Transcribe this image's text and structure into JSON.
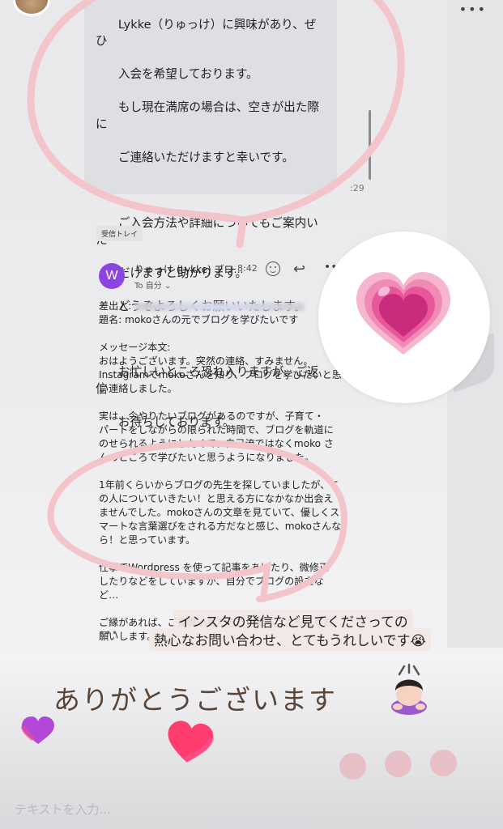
{
  "bubble": {
    "paragraphs": [
      [
        "Lykke（りゅっけ）に興味があり、ぜひ",
        "入会を希望しております。",
        "もし現在満席の場合は、空きが出た際に",
        "ご連絡いただけますと幸いです。"
      ],
      [
        "ご入会方法や詳細についてもご案内いた",
        "だけますと助かります。",
        "どうぞよろしくお願いいたします。"
      ],
      [
        "お忙しいところ恐れ入りますが、ご返信",
        "お待ちしております。"
      ]
    ],
    "time": ":29"
  },
  "inbox_tag": "受信トレイ",
  "mail": {
    "avatar_letter": "W",
    "sender": "りゅっけ (Lykke) ブロ…",
    "time": "8:42",
    "to_me": "To 自分 ⌄",
    "from_label": "差出人:",
    "subject": "題名: mokoさんの元でブログを学びたいです",
    "body_label": "メッセージ本文:",
    "body_paragraphs": [
      [
        "おはようございます。突然の連絡、すみません。",
        "Instagramでmokoさんを知り、ブログを学びたいと思",
        "い連絡しました。"
      ],
      [
        "実は、今やりたいブログがあるのですが、子育て・",
        "パートをしながらの限られた時間で、ブログを軌道に",
        "のせられるようにしたくて、自己流ではなくmoko さ",
        "んのところで学びたいと思うようになりました。"
      ],
      [
        "1年前くらいからブログの先生を探していましたが、こ",
        "の人についていきたい！と思える方になかなか出会え",
        "ませんでした。mokoさんの文章を見ていて、優しくス",
        "マートな言葉選びをされる方だなと感じ、mokoさんな",
        "ら！と思っています。"
      ],
      [
        "仕事でWordpress を使って記事をあげたり、微修正",
        "したりなどをしていますが、自分でブログの設立な",
        "ど…"
      ],
      [
        "ご縁があれば、ご指導いただきたいです。よろしくお",
        "願いします。"
      ]
    ],
    "ellipsis": "•••"
  },
  "caption": {
    "line1": "インスタの発信など見てくださっての",
    "line2": "熱心なお問い合わせ、とてもうれしいです😭"
  },
  "thanks_text": "ありがとうございます",
  "input": {
    "placeholder": "テキストを入力..."
  },
  "icons": [
    "heart-sticker-icon",
    "bowing-person-icon",
    "reply-icon",
    "emoji-reaction-icon",
    "more-icon",
    "heart-icon"
  ],
  "colors": {
    "doodle_circle": "#f3c4c9",
    "mail_avatar": "#8e44e0",
    "thanks_text": "#5a4638"
  }
}
